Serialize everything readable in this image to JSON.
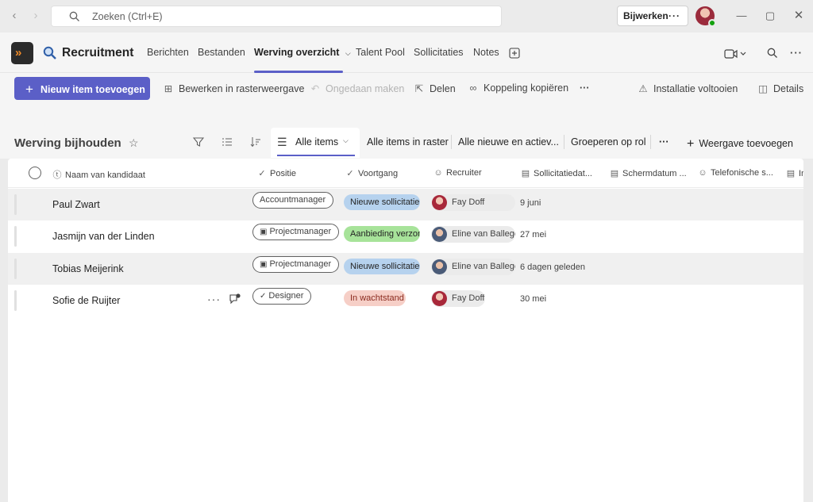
{
  "search": {
    "placeholder": "Zoeken (Ctrl+E)"
  },
  "update": {
    "label": "Bijwerken",
    "more": "···"
  },
  "app": {
    "title": "Recruitment",
    "tabs": [
      {
        "label": "Berichten"
      },
      {
        "label": "Bestanden"
      },
      {
        "label": "Werving overzicht"
      },
      {
        "label": "Talent Pool"
      },
      {
        "label": "Sollicitaties"
      },
      {
        "label": "Notes"
      }
    ]
  },
  "commands": {
    "new_item": "Nieuw item toevoegen",
    "grid_edit": "Bewerken in rasterweergave",
    "undo": "Ongedaan maken",
    "share": "Delen",
    "copy_link": "Koppeling kopiëren",
    "more": "···",
    "finish_setup": "Installatie voltooien",
    "details": "Details"
  },
  "view": {
    "title": "Werving bijhouden",
    "active_tab": "Alle items",
    "tabs": [
      {
        "label": "Alle items in raster"
      },
      {
        "label": "Alle nieuwe en actiev..."
      },
      {
        "label": "Groeperen op rol"
      }
    ],
    "more": "···",
    "add_view": "Weergave toevoegen"
  },
  "table": {
    "columns": [
      {
        "label": "Naam van kandidaat"
      },
      {
        "label": "Positie"
      },
      {
        "label": "Voortgang"
      },
      {
        "label": "Recruiter"
      },
      {
        "label": "Sollicitatiedat..."
      },
      {
        "label": "Schermdatum ..."
      },
      {
        "label": "Telefonische s..."
      },
      {
        "label": "In"
      }
    ],
    "rows": [
      {
        "name": "Paul Zwart",
        "position": "Accountmanager",
        "progress": "Nieuwe sollicitatie",
        "recruiter": "Fay Doff",
        "date": "9 juni"
      },
      {
        "name": "Jasmijn van der Linden",
        "position": "Projectmanager",
        "progress": "Aanbieding verzonden",
        "recruiter": "Eline van Ballegooijen",
        "date": "27 mei"
      },
      {
        "name": "Tobias Meijerink",
        "position": "Projectmanager",
        "progress": "Nieuwe sollicitatie",
        "recruiter": "Eline van Ballegooijen",
        "date": "6 dagen geleden"
      },
      {
        "name": "Sofie de Ruijter",
        "position": "Designer",
        "progress": "In wachtstand",
        "recruiter": "Fay Doff",
        "date": "30 mei",
        "row_more": "···"
      }
    ]
  },
  "colors": {
    "accent": "#5b5fc7",
    "status_new_bg": "#b6d2ee",
    "status_offer_bg": "#a7e39a",
    "status_hold_bg": "#f6cfc7"
  }
}
